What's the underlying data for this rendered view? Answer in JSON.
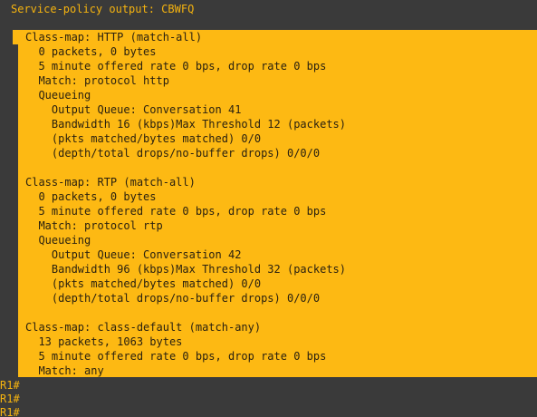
{
  "header": {
    "text": "Service-policy output: CBWFQ"
  },
  "output_lines": [
    "Class-map: HTTP (match-all)",
    "  0 packets, 0 bytes",
    "  5 minute offered rate 0 bps, drop rate 0 bps",
    "  Match: protocol http",
    "  Queueing",
    "    Output Queue: Conversation 41",
    "    Bandwidth 16 (kbps)Max Threshold 12 (packets)",
    "    (pkts matched/bytes matched) 0/0",
    "    (depth/total drops/no-buffer drops) 0/0/0",
    "",
    "Class-map: RTP (match-all)",
    "  0 packets, 0 bytes",
    "  5 minute offered rate 0 bps, drop rate 0 bps",
    "  Match: protocol rtp",
    "  Queueing",
    "    Output Queue: Conversation 42",
    "    Bandwidth 96 (kbps)Max Threshold 32 (packets)",
    "    (pkts matched/bytes matched) 0/0",
    "    (depth/total drops/no-buffer drops) 0/0/0",
    "",
    "Class-map: class-default (match-any)",
    "  13 packets, 1063 bytes",
    "  5 minute offered rate 0 bps, drop rate 0 bps",
    "  Match: any"
  ],
  "prompts": [
    "R1#",
    "R1#",
    "R1#"
  ],
  "colors": {
    "terminal_background": "#3a3a3a",
    "selection_highlight": "#fdb913",
    "prompt_text": "#f5b30f"
  }
}
